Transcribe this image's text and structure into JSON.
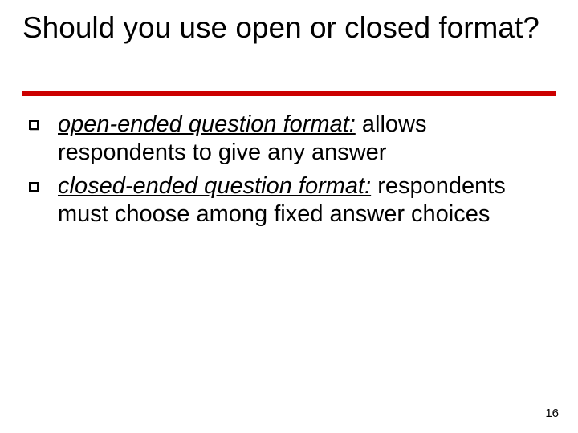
{
  "title": "Should you use open or closed format?",
  "bullets": [
    {
      "term": "open-ended question format:",
      "rest": " allows respondents to give any answer"
    },
    {
      "term": "closed-ended question format:",
      "rest": " respondents must choose among fixed answer choices"
    }
  ],
  "page_number": "16",
  "accent_color": "#cc0000"
}
